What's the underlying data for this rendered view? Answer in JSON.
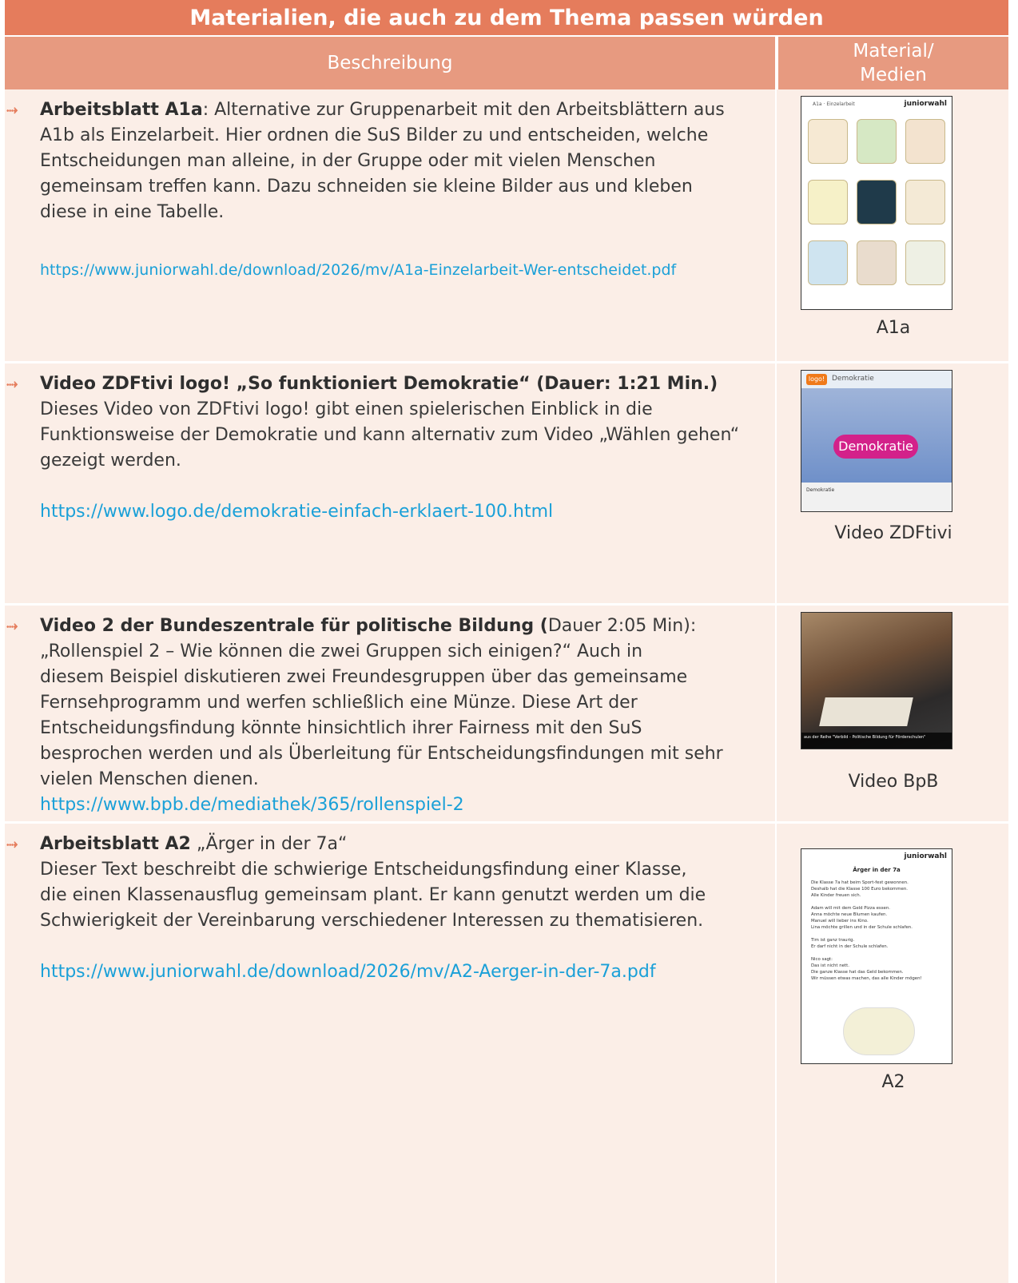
{
  "title": "Materialien, die auch zu dem Thema passen würden",
  "header": {
    "description": "Beschreibung",
    "media_line1": "Material/",
    "media_line2": "Medien"
  },
  "rows": [
    {
      "bold": "Arbeitsblatt A1a",
      "lead_rest": ": Alternative zur Gruppenarbeit mit den Arbeitsblättern aus",
      "body": [
        "A1b als Einzelarbeit. Hier ordnen die SuS Bilder zu und entscheiden, welche",
        "Entscheidungen man alleine, in der Gruppe oder mit vielen Menschen",
        "gemeinsam treffen kann. Dazu schneiden sie kleine Bilder aus und kleben",
        "diese in eine Tabelle."
      ],
      "link": "https://www.juniorwahl.de/download/2026/mv/A1a-Einzelarbeit-Wer-entscheidet.pdf",
      "caption": "A1a",
      "thumb_header": "A1a · Einzelarbeit",
      "thumb_logo": "juniorwahl"
    },
    {
      "bold": "Video ZDFtivi logo! „So funktioniert Demokratie“ (Dauer: 1:21 Min.)",
      "lead_rest": "",
      "body": [
        "Dieses Video von ZDFtivi logo! gibt einen spielerischen Einblick in die",
        "Funktionsweise der Demokratie und kann alternativ zum Video „Wählen gehen“",
        "gezeigt werden."
      ],
      "link": "https://www.logo.de/demokratie-einfach-erklaert-100.html",
      "caption": "Video ZDFtivi",
      "thumb_logo": "logo!",
      "thumb_label": "Demokratie",
      "thumb_pill": "Demokratie",
      "thumb_bottom": "Demokratie"
    },
    {
      "bold": "Video 2 der Bundeszentrale für politische Bildung (",
      "lead_rest": "Dauer 2:05 Min):",
      "body": [
        "„Rollenspiel 2 – Wie können die zwei Gruppen sich einigen?“ Auch in",
        "diesem Beispiel diskutieren zwei Freundesgruppen über das gemeinsame",
        "Fernsehprogramm und werfen schließlich eine Münze. Diese Art der",
        "Entscheidungsfindung könnte hinsichtlich ihrer Fairness mit den SuS",
        "besprochen werden und als Überleitung für Entscheidungsfindungen mit sehr",
        "vielen Menschen dienen."
      ],
      "link": "https://www.bpb.de/mediathek/365/rollenspiel-2",
      "caption": "Video BpB",
      "thumb_bar": "aus der Reihe \"Verbild - Politische Bildung für Förderschulen\""
    },
    {
      "bold": "Arbeitsblatt A2",
      "lead_rest": " „Ärger in der 7a“",
      "body": [
        "Dieser Text beschreibt die schwierige Entscheidungsfindung einer Klasse,",
        "die einen Klassenausflug gemeinsam plant. Er kann genutzt werden um die",
        "Schwierigkeit der Vereinbarung verschiedener Interessen zu thematisieren."
      ],
      "link": "https://www.juniorwahl.de/download/2026/mv/A2-Aerger-in-der-7a.pdf",
      "caption": "A2",
      "thumb_logo": "juniorwahl",
      "thumb_title": "Ärger in der 7a",
      "thumb_lines": [
        "Die Klasse 7a hat beim Sport-fest gewonnen.",
        "Deshalb hat die Klasse 100 Euro bekommen.",
        "Alle Kinder freuen sich.",
        "",
        "Adam will mit dem Geld Pizza essen.",
        "Anna möchte neue Blumen kaufen.",
        "Manuel will lieber ins Kino.",
        "Lina möchte grillen und in der Schule schlafen.",
        "",
        "Tim ist ganz traurig.",
        "Er darf nicht in der Schule schlafen.",
        "",
        "Nico sagt:",
        "Das ist nicht nett.",
        "Die ganze Klasse hat das Geld bekommen.",
        "Wir müssen etwas machen, das alle Kinder mögen!"
      ]
    }
  ],
  "colors": {
    "title_bg": "#e57c5c",
    "header_bg": "#e79a80",
    "row_bg": "#fbeee7",
    "link": "#1aa0d8"
  }
}
